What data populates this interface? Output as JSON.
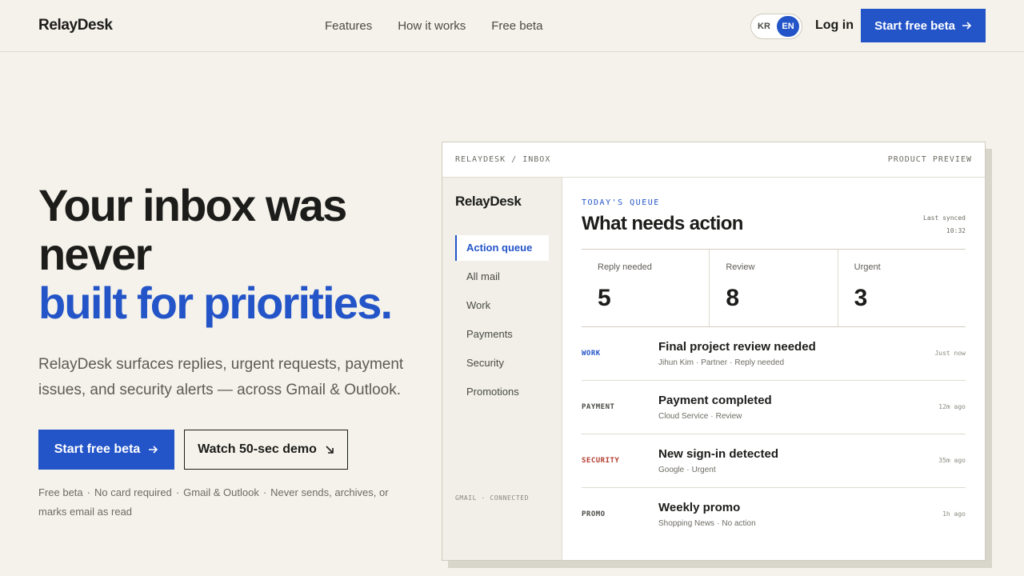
{
  "header": {
    "brand": "RelayDesk",
    "nav": [
      "Features",
      "How it works",
      "Free beta"
    ],
    "lang": {
      "options": [
        "KR",
        "EN"
      ],
      "selected": "EN"
    },
    "login": "Log in",
    "cta": "Start free beta"
  },
  "hero": {
    "headline_line1": "Your inbox was",
    "headline_line2": "never",
    "headline_line3": "built for priorities.",
    "subtext": "RelayDesk surfaces replies, urgent requests, payment issues, and security alerts — across Gmail & Outlook.",
    "primary_cta": "Start free beta",
    "secondary_cta": "Watch 50-sec demo",
    "fine_print": [
      "Free beta",
      "No card required",
      "Gmail & Outlook",
      "Never sends, archives, or marks email as read"
    ]
  },
  "preview": {
    "breadcrumb": "RELAYDESK / INBOX",
    "badge": "PRODUCT PREVIEW",
    "sidebar": {
      "brand": "RelayDesk",
      "items": [
        "Action queue",
        "All mail",
        "Work",
        "Payments",
        "Security",
        "Promotions"
      ],
      "active": "Action queue",
      "footer": "GMAIL · CONNECTED"
    },
    "queue_label": "TODAY'S QUEUE",
    "title": "What needs action",
    "synced_label": "Last synced",
    "synced_time": "10:32",
    "stats": [
      {
        "label": "Reply needed",
        "value": "5"
      },
      {
        "label": "Review",
        "value": "8"
      },
      {
        "label": "Urgent",
        "value": "3"
      }
    ],
    "mails": [
      {
        "tag": "WORK",
        "tag_color": "#2354c8",
        "subject": "Final project review needed",
        "meta": [
          "Jihun Kim",
          "Partner",
          "Reply needed"
        ],
        "time": "Just now"
      },
      {
        "tag": "PAYMENT",
        "tag_color": "#4a4a46",
        "subject": "Payment completed",
        "meta": [
          "Cloud Service",
          "Review"
        ],
        "time": "12m ago"
      },
      {
        "tag": "SECURITY",
        "tag_color": "#b23b2e",
        "subject": "New sign-in detected",
        "meta": [
          "Google",
          "Urgent"
        ],
        "time": "35m ago"
      },
      {
        "tag": "PROMO",
        "tag_color": "#4a4a46",
        "subject": "Weekly promo",
        "meta": [
          "Shopping News",
          "No action"
        ],
        "time": "1h ago"
      }
    ]
  },
  "colors": {
    "accent": "#2354c8",
    "background": "#f4f2ea",
    "security": "#b23b2e"
  },
  "icons": {
    "cta_arrow": "arrow-right-icon",
    "demo_arrow": "arrow-down-right-icon"
  }
}
